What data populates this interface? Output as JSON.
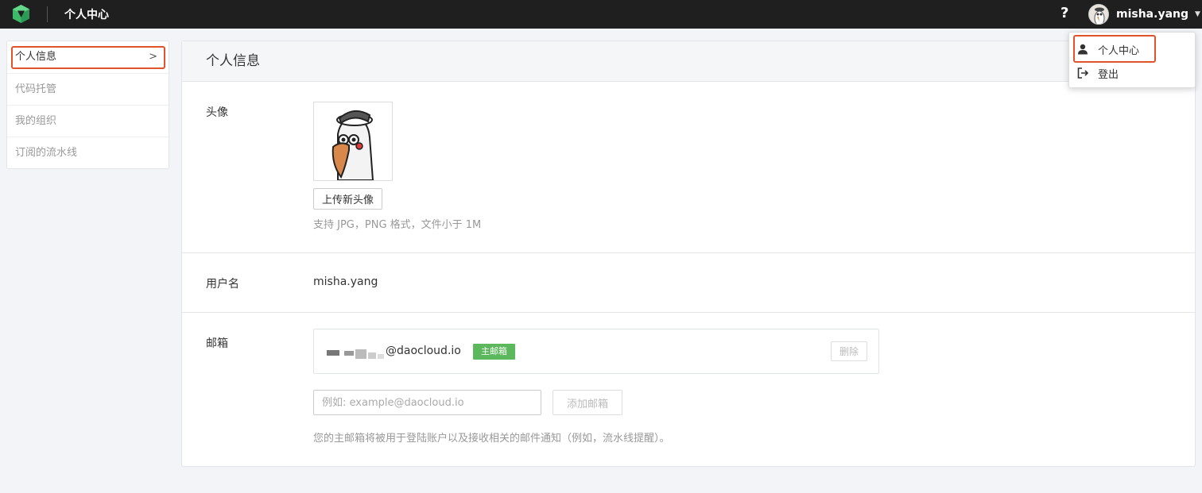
{
  "topbar": {
    "page_title": "个人中心",
    "help_label": "?",
    "user_name": "misha.yang"
  },
  "sidebar": {
    "items": [
      {
        "label": "个人信息",
        "active": true
      },
      {
        "label": "代码托管",
        "active": false
      },
      {
        "label": "我的组织",
        "active": false
      },
      {
        "label": "订阅的流水线",
        "active": false
      }
    ]
  },
  "main": {
    "title": "个人信息",
    "avatar": {
      "label": "头像",
      "upload_button": "上传新头像",
      "hint": "支持 JPG，PNG 格式，文件小于 1M"
    },
    "username": {
      "label": "用户名",
      "value": "misha.yang"
    },
    "email": {
      "label": "邮箱",
      "address_domain": "@daocloud.io",
      "primary_badge": "主邮箱",
      "delete_button": "删除",
      "input_placeholder": "例如: example@daocloud.io",
      "add_button": "添加邮箱",
      "note": "您的主邮箱将被用于登陆账户以及接收相关的邮件通知（例如，流水线提醒）。"
    }
  },
  "dropdown": {
    "items": [
      {
        "label": "个人中心",
        "icon": "user-icon"
      },
      {
        "label": "登出",
        "icon": "logout-icon"
      }
    ]
  },
  "colors": {
    "topbar": "#1f1f1f",
    "highlight": "#e0532b",
    "badge": "#5cb85c",
    "logo": "#3cba6a"
  }
}
